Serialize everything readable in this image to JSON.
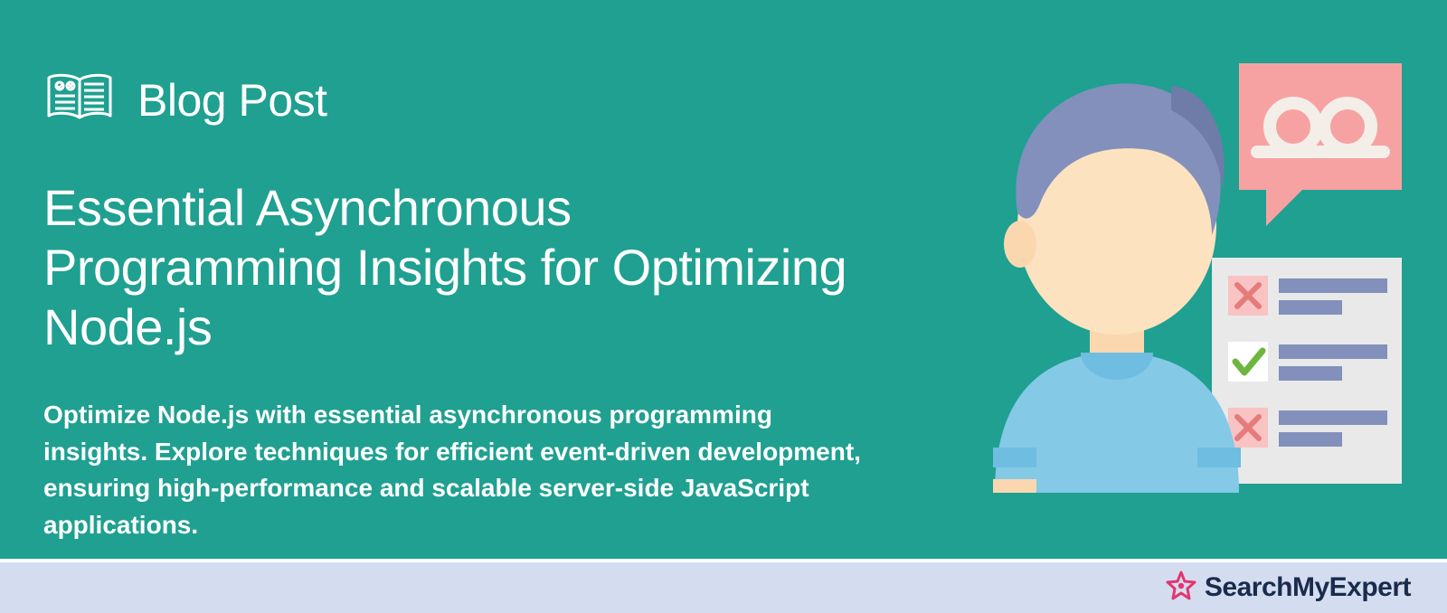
{
  "badge": {
    "label": "Blog Post"
  },
  "title": "Essential Asynchronous Programming Insights for Optimizing Node.js",
  "description": "Optimize Node.js with essential asynchronous programming insights. Explore techniques for efficient event-driven development, ensuring high-performance and scalable server-side JavaScript applications.",
  "brand": {
    "name": "SearchMyExpert"
  },
  "colors": {
    "banner_bg": "#1fa091",
    "footer_bg": "#d4ddf0",
    "brand_text": "#1a2b4c",
    "brand_star": "#e2366f"
  }
}
